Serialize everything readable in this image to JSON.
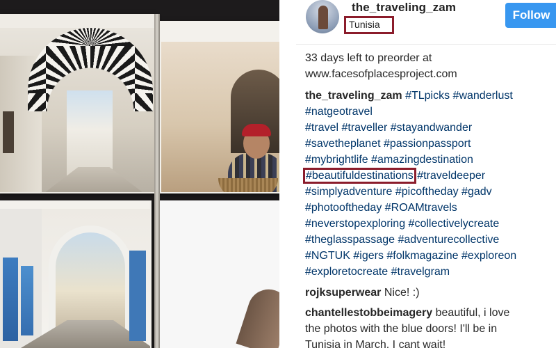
{
  "post": {
    "username": "the_traveling_zam",
    "location": "Tunisia",
    "follow_label": "Follow",
    "preorder_lines": [
      "33 days left to preorder at",
      "www.facesofplacesproject.com"
    ],
    "caption_user": "the_traveling_zam",
    "caption_lines": [
      [
        "#TLpicks",
        "#wanderlust"
      ],
      [
        "#natgeotravel"
      ],
      [
        "#travel",
        "#traveller",
        "#stayandwander"
      ],
      [
        "#savetheplanet",
        "#passionpassport"
      ],
      [
        "#mybrightlife",
        "#amazingdestination"
      ],
      [
        "#beautifuldestinations",
        "#traveldeeper"
      ],
      [
        "#simplyadventure",
        "#picoftheday",
        "#gadv"
      ],
      [
        "#photooftheday",
        "#ROAMtravels"
      ],
      [
        "#neverstopexploring",
        "#collectivelycreate"
      ],
      [
        "#theglasspassage",
        "#adventurecollective"
      ],
      [
        "#NGTUK",
        "#igers",
        "#folkmagazine",
        "#exploreon"
      ],
      [
        "#exploretocreate",
        "#travelgram"
      ]
    ],
    "highlighted_tag": "#beautifuldestinations"
  },
  "comments": [
    {
      "user": "rojksuperwear",
      "lines": [
        "Nice! :)"
      ]
    },
    {
      "user": "chantellestobbeimagery",
      "lines": [
        "beautiful, i love",
        "the photos with the blue doors! I'll be in",
        "Tunisia in March. I cant wait!"
      ]
    }
  ],
  "colors": {
    "follow": "#3897f0",
    "highlight_box": "#8b1c2b",
    "hashtag": "#003569",
    "text": "#262626"
  }
}
